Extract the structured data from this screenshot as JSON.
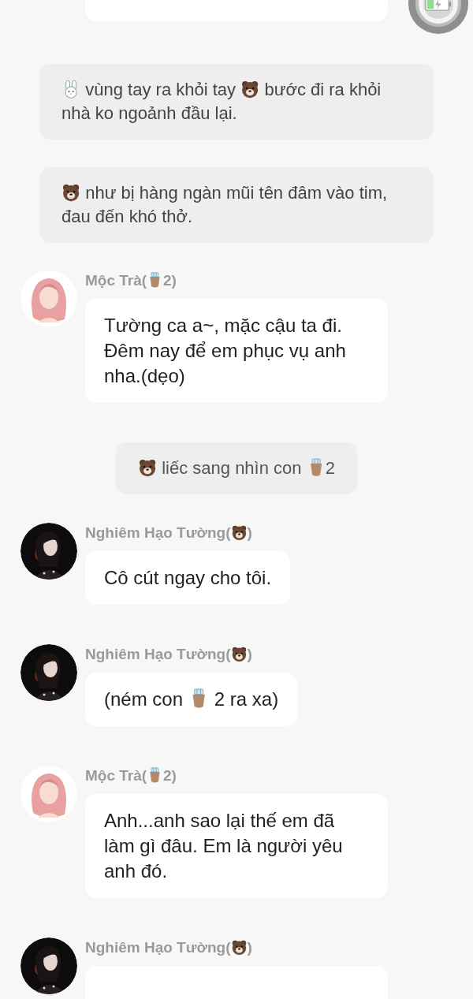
{
  "chat": [
    {
      "kind": "message"
    },
    {
      "kind": "narration",
      "parts": [
        {
          "kind": "rabbit"
        },
        {
          "kind": "text",
          "text": " vùng tay ra khỏi tay "
        },
        {
          "kind": "bear"
        },
        {
          "kind": "text",
          "text": " bước đi ra khỏi nhà ko ngoảnh đầu lại."
        }
      ]
    },
    {
      "kind": "narration",
      "parts": [
        {
          "kind": "bear"
        },
        {
          "kind": "text",
          "text": " như bị hàng ngàn mũi tên đâm vào tim, đau đến khó thở."
        }
      ]
    },
    {
      "kind": "message",
      "avatar": {
        "kind": "pink"
      },
      "sender": [
        {
          "kind": "text",
          "text": "Mộc Trà("
        },
        {
          "kind": "cup"
        },
        {
          "kind": "text",
          "text": "2)"
        }
      ],
      "parts": [
        {
          "kind": "text",
          "text": "Tường ca a~, mặc cậu ta đi. Đêm nay để em phục vụ anh nha.(dẹo)"
        }
      ]
    },
    {
      "kind": "action",
      "parts": [
        {
          "kind": "bear"
        },
        {
          "kind": "text",
          "text": " liếc sang nhìn con "
        },
        {
          "kind": "cup"
        },
        {
          "kind": "text",
          "text": "2"
        }
      ]
    },
    {
      "kind": "message",
      "avatar": {
        "kind": "dark"
      },
      "sender": [
        {
          "kind": "text",
          "text": "Nghiêm Hạo Tường("
        },
        {
          "kind": "bear"
        },
        {
          "kind": "text",
          "text": ")"
        }
      ],
      "parts": [
        {
          "kind": "text",
          "text": "Cô cút ngay cho tôi."
        }
      ]
    },
    {
      "kind": "message",
      "avatar": {
        "kind": "dark"
      },
      "sender": [
        {
          "kind": "text",
          "text": "Nghiêm Hạo Tường("
        },
        {
          "kind": "bear"
        },
        {
          "kind": "text",
          "text": ")"
        }
      ],
      "parts": [
        {
          "kind": "text",
          "text": "(ném con "
        },
        {
          "kind": "cup"
        },
        {
          "kind": "text",
          "text": " 2 ra xa)"
        }
      ]
    },
    {
      "kind": "message",
      "avatar": {
        "kind": "pink"
      },
      "sender": [
        {
          "kind": "text",
          "text": "Mộc Trà("
        },
        {
          "kind": "cup"
        },
        {
          "kind": "text",
          "text": "2)"
        }
      ],
      "parts": [
        {
          "kind": "text",
          "text": "Anh...anh sao lại thế em đã làm gì đâu. Em là người yêu anh đó."
        }
      ]
    },
    {
      "kind": "message",
      "avatar": {
        "kind": "dark"
      },
      "sender": [
        {
          "kind": "text",
          "text": "Nghiêm Hạo Tường("
        },
        {
          "kind": "bear"
        },
        {
          "kind": "text",
          "text": ")"
        }
      ]
    }
  ],
  "floating_button": {
    "kind": "battery"
  }
}
